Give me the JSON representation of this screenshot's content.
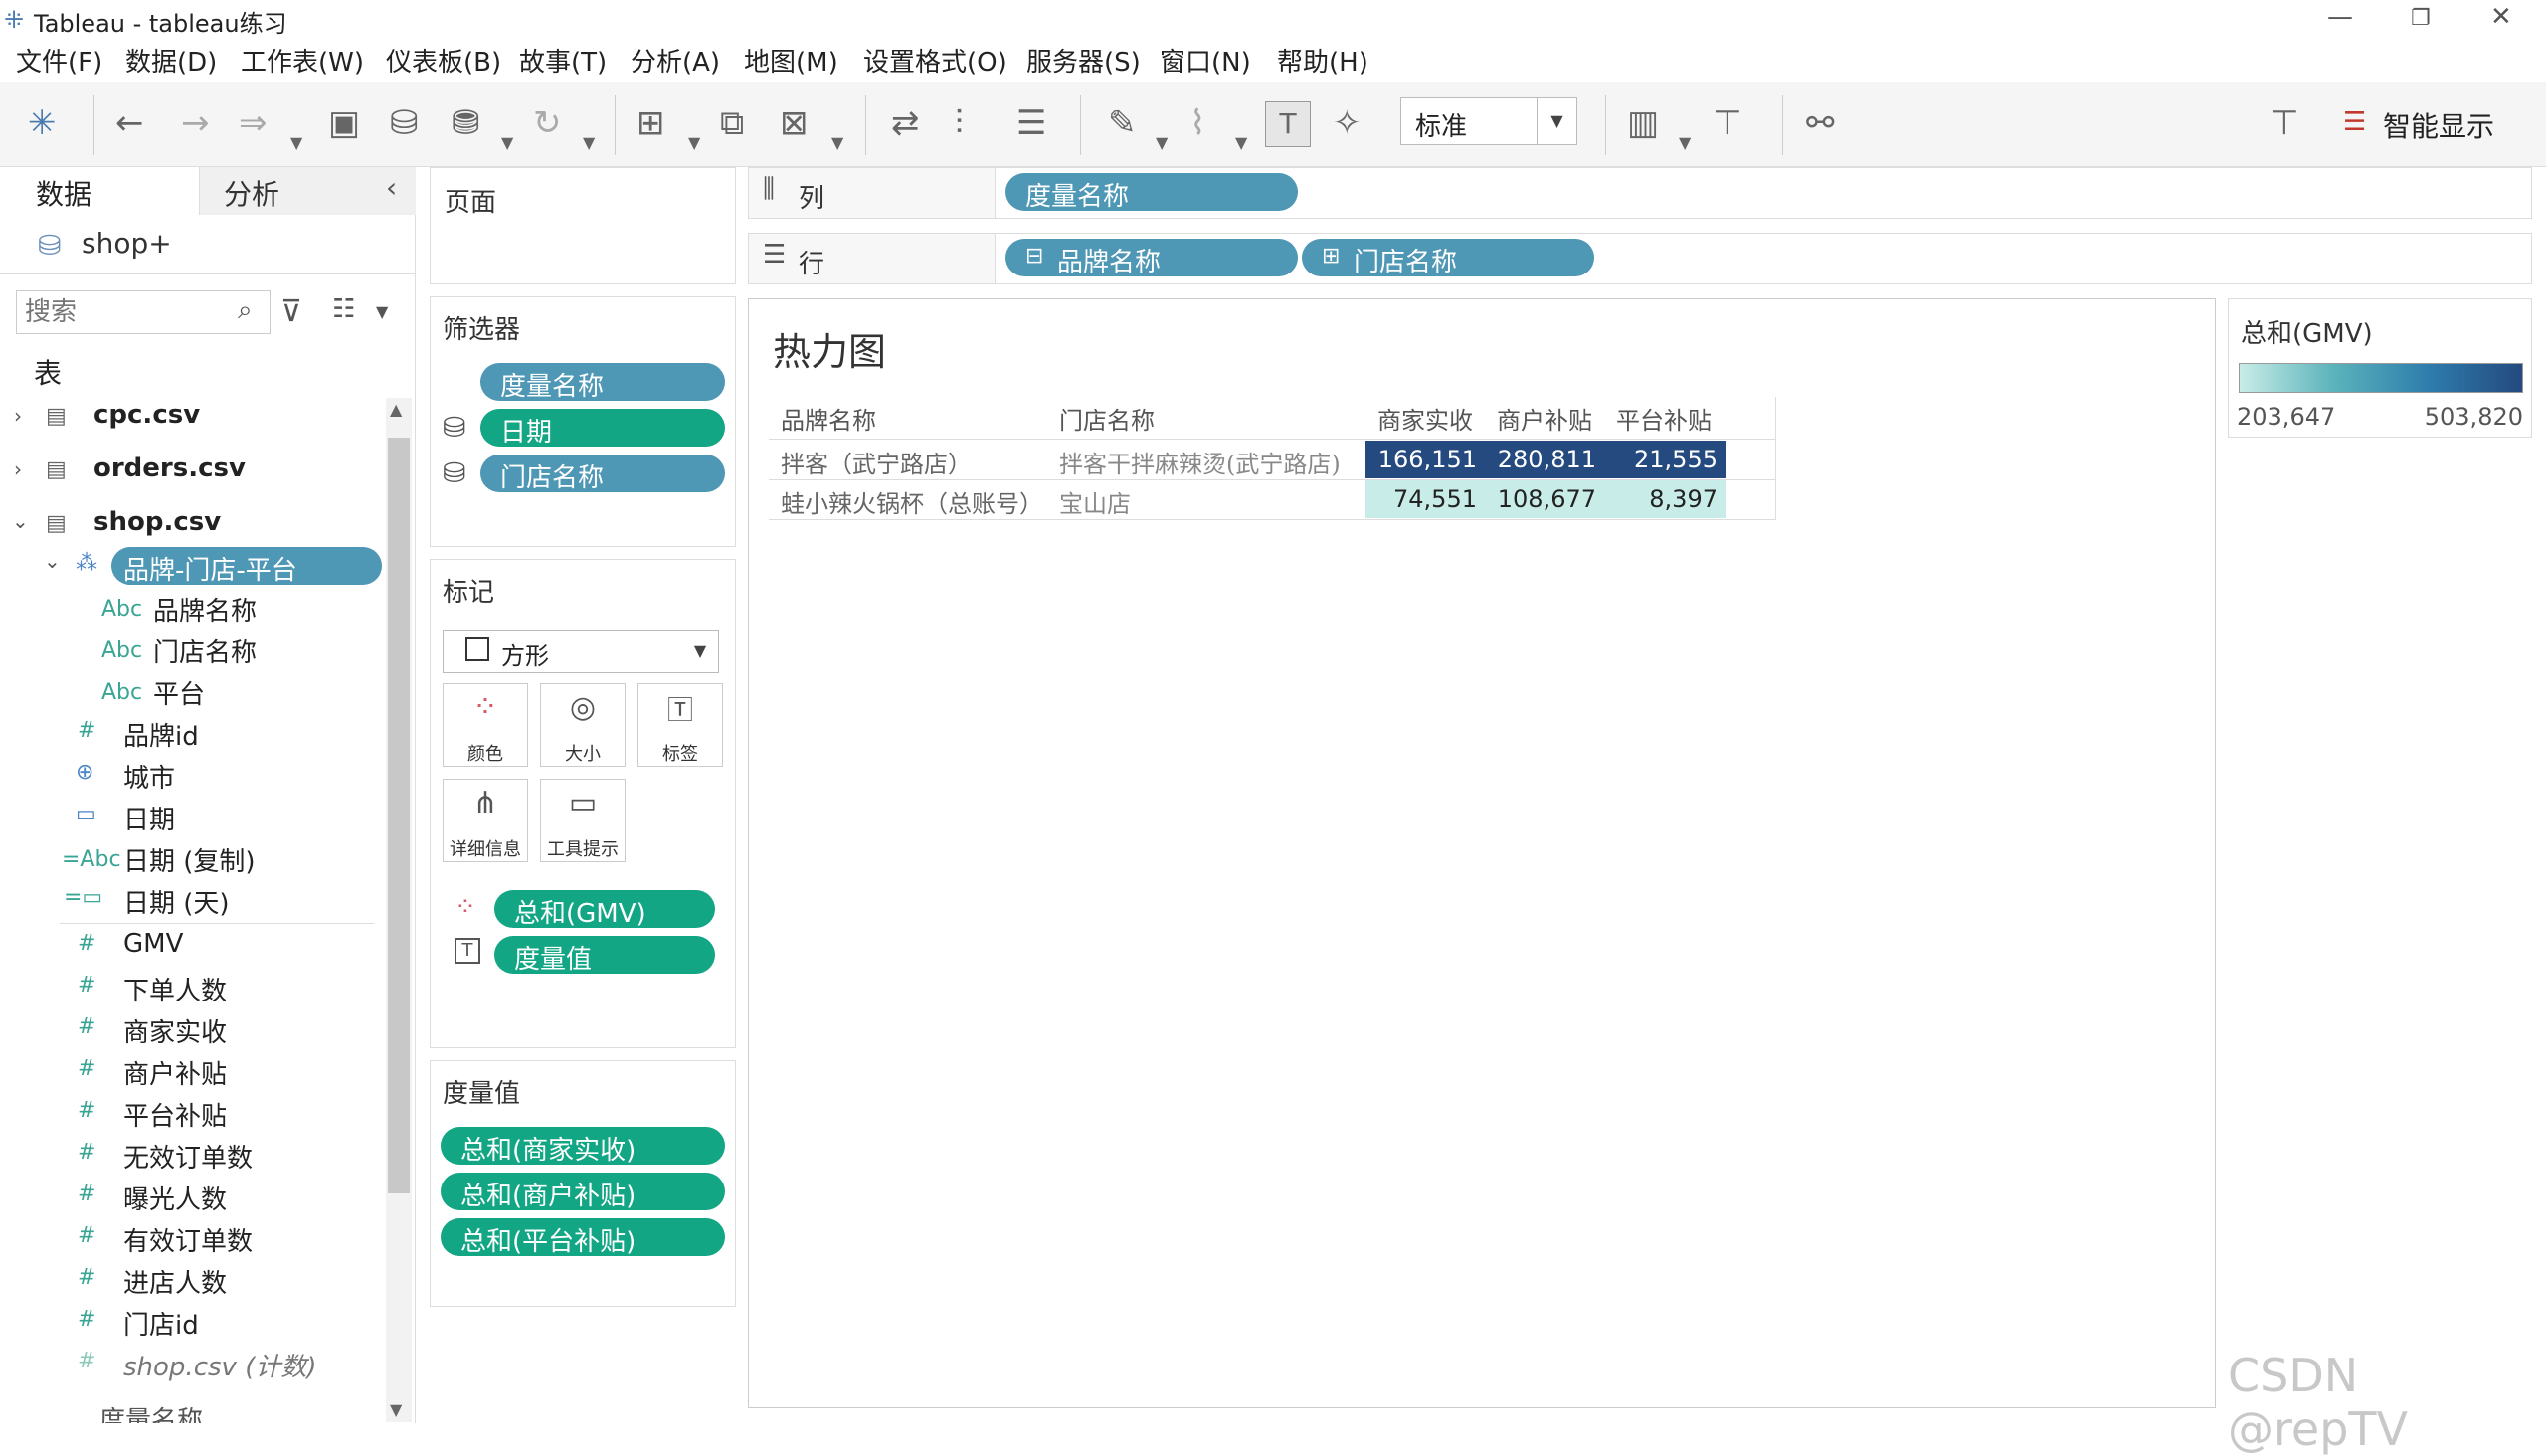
{
  "window": {
    "title": "Tableau - tableau练习"
  },
  "menu": [
    "文件(F)",
    "数据(D)",
    "工作表(W)",
    "仪表板(B)",
    "故事(T)",
    "分析(A)",
    "地图(M)",
    "设置格式(O)",
    "服务器(S)",
    "窗口(N)",
    "帮助(H)"
  ],
  "toolbar": {
    "fit_select": "标准",
    "show_me": "智能显示"
  },
  "data_pane": {
    "tab_data": "数据",
    "tab_analysis": "分析",
    "datasource": "shop+",
    "search_placeholder": "搜索",
    "tables_label": "表",
    "tables": [
      "cpc.csv",
      "orders.csv",
      "shop.csv"
    ],
    "hierarchy": "品牌-门店-平台",
    "hierarchy_fields": [
      "品牌名称",
      "门店名称",
      "平台"
    ],
    "fields": [
      {
        "type": "#",
        "name": "品牌id"
      },
      {
        "type": "⊕",
        "name": "城市"
      },
      {
        "type": "▭",
        "name": "日期"
      },
      {
        "type": "=Abc",
        "name": "日期 (复制)"
      },
      {
        "type": "=▭",
        "name": "日期 (天)"
      },
      {
        "type": "#",
        "name": "GMV"
      },
      {
        "type": "#",
        "name": "下单人数"
      },
      {
        "type": "#",
        "name": "商家实收"
      },
      {
        "type": "#",
        "name": "商户补贴"
      },
      {
        "type": "#",
        "name": "平台补贴"
      },
      {
        "type": "#",
        "name": "无效订单数"
      },
      {
        "type": "#",
        "name": "曝光人数"
      },
      {
        "type": "#",
        "name": "有效订单数"
      },
      {
        "type": "#",
        "name": "进店人数"
      },
      {
        "type": "#",
        "name": "门店id"
      },
      {
        "type": "#",
        "name": "shop.csv (计数)"
      }
    ],
    "cut_off_field": "度量名称"
  },
  "pages_card": {
    "title": "页面"
  },
  "filters_card": {
    "title": "筛选器",
    "pills": [
      "度量名称",
      "日期",
      "门店名称"
    ]
  },
  "marks_card": {
    "title": "标记",
    "mark_type": "方形",
    "buttons": [
      "颜色",
      "大小",
      "标签",
      "详细信息",
      "工具提示"
    ],
    "pills": [
      "总和(GMV)",
      "度量值"
    ]
  },
  "measure_values_card": {
    "title": "度量值",
    "pills": [
      "总和(商家实收)",
      "总和(商户补贴)",
      "总和(平台补贴)"
    ]
  },
  "columns_shelf": {
    "label": "列",
    "pills": [
      "度量名称"
    ]
  },
  "rows_shelf": {
    "label": "行",
    "pills": [
      "品牌名称",
      "门店名称"
    ]
  },
  "view": {
    "title": "热力图",
    "headers": [
      "品牌名称",
      "门店名称",
      "商家实收",
      "商户补贴",
      "平台补贴"
    ],
    "rows": [
      {
        "brand": "拌客（武宁路店）",
        "store": "拌客干拌麻辣烫(武宁路店)",
        "values": [
          "166,151",
          "280,811",
          "21,555"
        ],
        "gmv": 503820
      },
      {
        "brand": "蛙小辣火锅杯（总账号）",
        "store": "宝山店",
        "values": [
          "74,551",
          "108,677",
          "8,397"
        ],
        "gmv": 203647
      }
    ]
  },
  "legend": {
    "title": "总和(GMV)",
    "min": "203,647",
    "max": "503,820"
  },
  "watermark": "CSDN @repTV",
  "colors": {
    "blue_pill": "#4e97b5",
    "green_pill": "#12a684",
    "heat_high": "#244a7f",
    "heat_low": "#c8ece7"
  }
}
